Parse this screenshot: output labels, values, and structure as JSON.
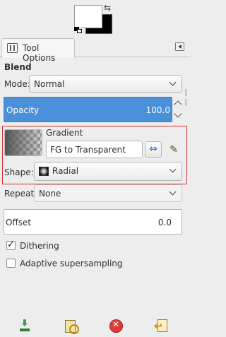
{
  "colors": {
    "foreground": "#ffffff",
    "background": "#000000",
    "accent": "#4a90d9",
    "highlight_border": "#d32f2f"
  },
  "tab": {
    "label": "Tool Options",
    "icon": "tool-options-icon"
  },
  "tool": {
    "name": "Blend",
    "mode_label": "Mode:",
    "mode_value": "Normal",
    "opacity_label": "Opacity",
    "opacity_value": "100.0",
    "gradient_label": "Gradient",
    "gradient_value": "FG to Transparent",
    "shape_label": "Shape:",
    "shape_value": "Radial",
    "repeat_label": "Repeat:",
    "repeat_value": "None",
    "offset_label": "Offset",
    "offset_value": "0.0",
    "dithering_label": "Dithering",
    "dithering_checked": true,
    "adaptive_label": "Adaptive supersampling",
    "adaptive_checked": false
  },
  "bottom_buttons": [
    {
      "icon": "save-options-icon"
    },
    {
      "icon": "restore-options-icon"
    },
    {
      "icon": "delete-options-icon"
    },
    {
      "icon": "reset-options-icon"
    }
  ]
}
